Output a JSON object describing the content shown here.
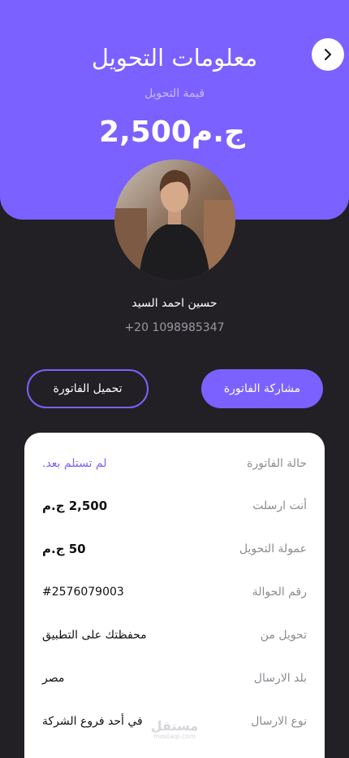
{
  "header": {
    "title": "معلومات التحويل",
    "amount_label": "قيمة التحويل",
    "amount": "ج.م2,500"
  },
  "recipient": {
    "name": "حسين احمد السيد",
    "phone": "+20 1098985347"
  },
  "actions": {
    "share_label": "مشاركة الفاتورة",
    "download_label": "تحميل الفاتورة"
  },
  "details": [
    {
      "label": "حالة الفاتورة",
      "value": "لم تستلم بعد."
    },
    {
      "label": "أنت ارسلت",
      "value": "2,500 ج.م"
    },
    {
      "label": "عمولة التحويل",
      "value": "50 ج.م"
    },
    {
      "label": "رقم الحوالة",
      "value": "#2576079003"
    },
    {
      "label": "تحويل من",
      "value": "محفظتك على التطبيق"
    },
    {
      "label": "بلد الارسال",
      "value": "مصر"
    },
    {
      "label": "نوع الارسال",
      "value": "في أحد فروع الشركة"
    }
  ],
  "watermark": {
    "brand": "مستقل",
    "domain": "mostaql.com"
  },
  "colors": {
    "accent": "#7b61ff",
    "background": "#222024",
    "card": "#ffffff"
  },
  "icons": {
    "back": "chevron-right-icon"
  }
}
